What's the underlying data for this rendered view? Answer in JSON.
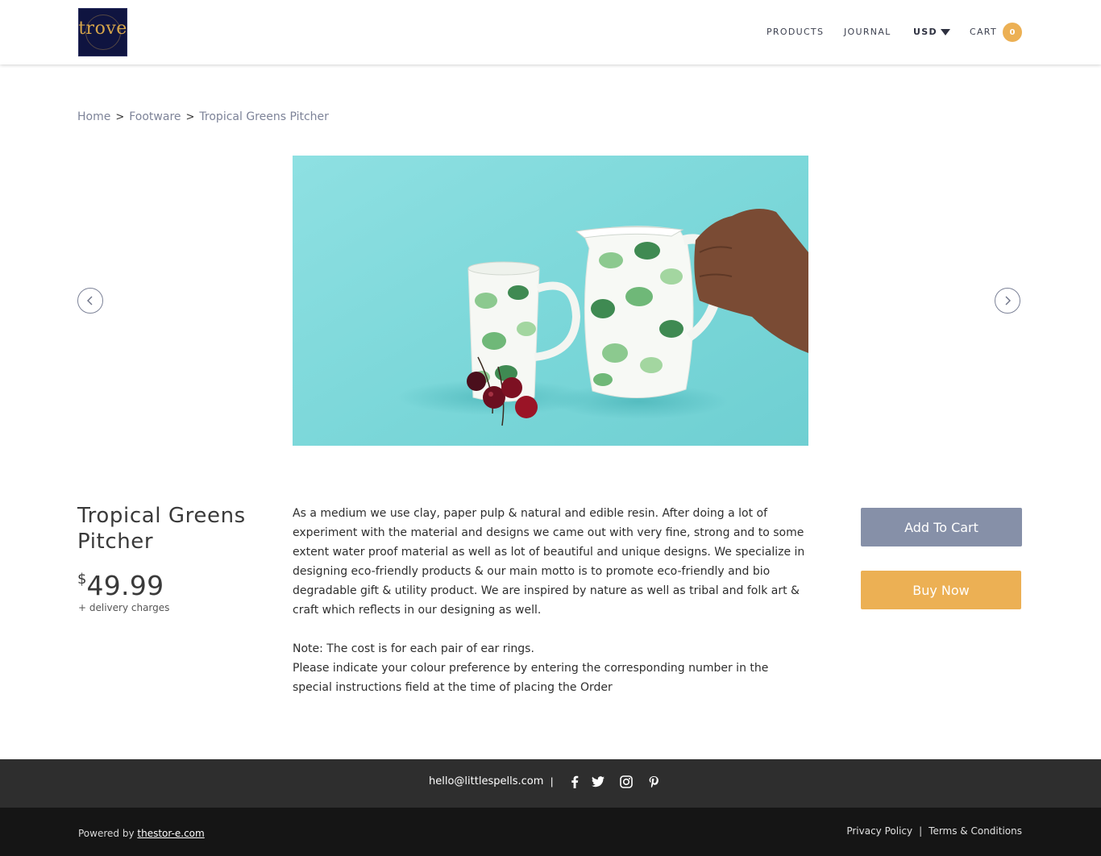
{
  "header": {
    "logo_text": "trove",
    "nav": {
      "products": "PRODUCTS",
      "journal": "JOURNAL",
      "currency": "USD",
      "cart": "CART",
      "cart_count": "0"
    }
  },
  "breadcrumb": {
    "home": "Home",
    "category": "Footware",
    "current": "Tropical Greens Pitcher",
    "separator": ">"
  },
  "product": {
    "title": "Tropical Greens Pitcher",
    "currency_symbol": "$",
    "price": "49.99",
    "delivery_note": "+ delivery charges",
    "description": "As a medium we use clay, paper pulp & natural and edible resin. After doing a lot of experiment with the material and designs we came out with very fine, strong and to some extent water proof material as well as lot of beautiful and unique designs. We specialize in designing eco-friendly products & our main motto is to promote eco-friendly and bio degradable gift & utility product. We are inspired by nature as well as tribal and folk art & craft which reflects in our designing as well.",
    "note_line1": "Note: The cost is for each pair of ear rings.",
    "note_line2": "Please indicate your colour preference by entering the corresponding number in the special instructions field at the time of placing the Order",
    "add_to_cart_label": "Add To Cart",
    "buy_now_label": "Buy Now"
  },
  "footer": {
    "email": "hello@littlespells.com",
    "separator": "|",
    "powered_by": "Powered by",
    "powered_link": "thestor-e.com",
    "privacy": "Privacy Policy",
    "legal_sep": "|",
    "terms": "Terms & Conditions"
  },
  "colors": {
    "accent_orange": "#ecb054",
    "slate_button": "#8690a8",
    "image_background": "#7fd9d9"
  },
  "icons": [
    "chevron-left-icon",
    "chevron-right-icon",
    "facebook-icon",
    "twitter-icon",
    "instagram-icon",
    "pinterest-icon",
    "caret-down-icon"
  ]
}
